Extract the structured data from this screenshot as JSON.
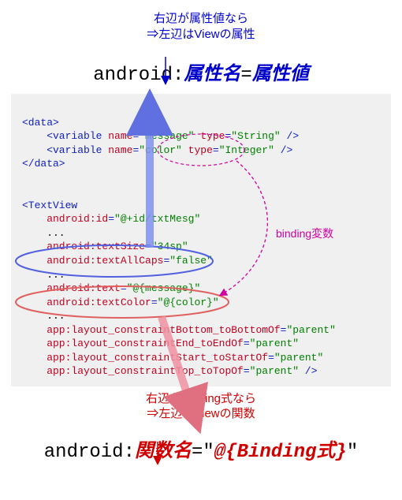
{
  "top_annotation": {
    "line1": "右辺が属性値なら",
    "line2": "⇒左辺はViewの属性"
  },
  "top_syntax": {
    "prefix": "android:",
    "attr_name": "属性名",
    "eq": "=",
    "attr_value": "属性値"
  },
  "code": {
    "data_open": "<data>",
    "var1_a": "    <variable ",
    "var1_b": "name",
    "var1_c": "=",
    "var1_d": "\"message\"",
    "var1_e": " type",
    "var1_f": "=",
    "var1_g": "\"String\"",
    "var1_h": " />",
    "var2_a": "    <variable ",
    "var2_b": "name",
    "var2_c": "=",
    "var2_d": "\"color\"",
    "var2_e": " type",
    "var2_f": "=",
    "var2_g": "\"Integer\"",
    "var2_h": " />",
    "data_close": "</data>",
    "tv_open": "<TextView",
    "id_a": "    android:id",
    "id_b": "=",
    "id_c": "\"@+id/txtMesg\"",
    "dots": "    ...",
    "ts_a": "    android:textSize",
    "ts_b": "=",
    "ts_c": "\"34sp\"",
    "ac_a": "    android:textAllCaps",
    "ac_b": "=",
    "ac_c": "\"false\"",
    "tx_a": "    android:text",
    "tx_b": "=",
    "tx_c": "\"@{message}\"",
    "tc_a": "    android:textColor",
    "tc_b": "=",
    "tc_c": "\"@{color}\"",
    "c1_a": "    app:layout_constraintBottom_toBottomOf",
    "c1_b": "=",
    "c1_c": "\"parent\"",
    "c2_a": "    app:layout_constraintEnd_toEndOf",
    "c2_b": "=",
    "c2_c": "\"parent\"",
    "c3_a": "    app:layout_constraintStart_toStartOf",
    "c3_b": "=",
    "c3_c": "\"parent\"",
    "c4_a": "    app:layout_constraintTop_toTopOf",
    "c4_b": "=",
    "c4_c": "\"parent\"",
    "c4_d": " />"
  },
  "magenta_label": "binding変数",
  "bottom_annotation": {
    "line1": "右辺がBinding式なら",
    "line2": "⇒左辺はViewの関数"
  },
  "bottom_syntax": {
    "prefix": "android:",
    "func_name": "関数名",
    "eq_open": "=\"",
    "binding": "@{Binding式}",
    "close": "\""
  }
}
